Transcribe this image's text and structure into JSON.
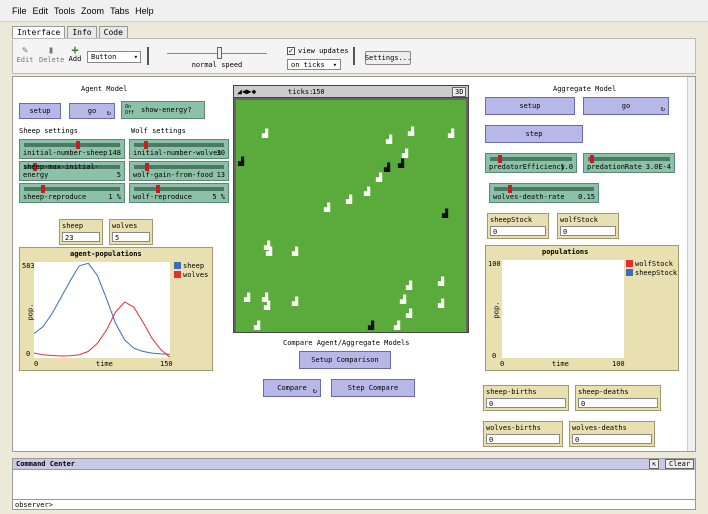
{
  "menu": [
    "File",
    "Edit",
    "Tools",
    "Zoom",
    "Tabs",
    "Help"
  ],
  "tabs": [
    "Interface",
    "Info",
    "Code"
  ],
  "toolbar": {
    "edit": "Edit",
    "delete": "Delete",
    "add": "Add",
    "widget_select": "Button",
    "speed_label": "normal speed",
    "view_updates": "view updates",
    "on_ticks": "on ticks",
    "settings": "Settings..."
  },
  "agent_model": {
    "title": "Agent Model",
    "setup": "setup",
    "go": "go",
    "show_energy": "show-energy?",
    "switch_on": "On",
    "switch_off": "Off",
    "sheep_settings": "Sheep settings",
    "wolf_settings": "Wolf settings",
    "sliders": [
      {
        "label": "initial-number-sheep",
        "value": "148",
        "frac": 0.57
      },
      {
        "label": "initial-number-wolves",
        "value": "30",
        "frac": 0.12
      },
      {
        "label": "sheep-max-initial-energy",
        "value": "5",
        "frac": 0.1
      },
      {
        "label": "wolf-gain-from-food",
        "value": "13",
        "frac": 0.13
      },
      {
        "label": "sheep-reproduce",
        "value": "1 %",
        "frac": 0.18
      },
      {
        "label": "wolf-reproduce",
        "value": "5 %",
        "frac": 0.25
      }
    ],
    "sheep_monitor": {
      "label": "sheep",
      "value": "23"
    },
    "wolves_monitor": {
      "label": "wolves",
      "value": "5"
    },
    "plot_title": "agent-populations",
    "y_max": "583",
    "y_min": "0",
    "x_min": "0",
    "x_max": "150",
    "x_label": "time",
    "y_label": "pop.",
    "legend": [
      "sheep",
      "wolves"
    ]
  },
  "view": {
    "ticks_label": "ticks:",
    "ticks": "150",
    "three_d": "3D"
  },
  "compare": {
    "title": "Compare Agent/Aggregate Models",
    "setup_comparison": "Setup Comparison",
    "compare": "Compare",
    "step_compare": "Step Compare"
  },
  "aggregate_model": {
    "title": "Aggregate Model",
    "setup": "setup",
    "go": "go",
    "step": "step",
    "sliders": [
      {
        "label": "predatorEfficiency",
        "value": "1.0",
        "frac": 0.1
      },
      {
        "label": "predationRate",
        "value": "3.0E-4",
        "frac": 0.03
      },
      {
        "label": "wolves-death-rate",
        "value": "0.15",
        "frac": 0.15
      }
    ],
    "sheepStock": {
      "label": "sheepStock",
      "value": "0"
    },
    "wolfStock": {
      "label": "wolfStock",
      "value": "0"
    },
    "plot_title": "populations",
    "y_max": "100",
    "y_min": "0",
    "x_min": "0",
    "x_max": "100",
    "x_label": "time",
    "y_label": "pop.",
    "legend": [
      "wolfStock",
      "sheepStock"
    ],
    "sheep_births": {
      "label": "sheep-births",
      "value": "0"
    },
    "sheep_deaths": {
      "label": "sheep-deaths",
      "value": "0"
    },
    "wolves_births": {
      "label": "wolves-births",
      "value": "0"
    },
    "wolves_deaths": {
      "label": "wolves-deaths",
      "value": "0"
    }
  },
  "command_center": {
    "title": "Command Center",
    "clear": "Clear",
    "observer": "observer>"
  },
  "colors": {
    "sheep_line": "#3a6db8",
    "wolves_line": "#e03030",
    "world": "#5aab3c"
  },
  "chart_data": {
    "type": "line",
    "title": "agent-populations",
    "xlabel": "time",
    "ylabel": "pop.",
    "xlim": [
      0,
      150
    ],
    "ylim": [
      0,
      583
    ],
    "series": [
      {
        "name": "sheep",
        "x": [
          0,
          10,
          20,
          30,
          40,
          50,
          60,
          70,
          80,
          90,
          100,
          110,
          120,
          130,
          140,
          150
        ],
        "values": [
          148,
          190,
          270,
          370,
          470,
          560,
          575,
          500,
          360,
          210,
          110,
          60,
          40,
          30,
          25,
          23
        ]
      },
      {
        "name": "wolves",
        "x": [
          0,
          10,
          20,
          30,
          40,
          50,
          60,
          70,
          80,
          90,
          100,
          110,
          120,
          130,
          140,
          150
        ],
        "values": [
          30,
          20,
          15,
          12,
          14,
          20,
          40,
          90,
          170,
          280,
          340,
          310,
          220,
          120,
          50,
          5
        ]
      }
    ]
  }
}
